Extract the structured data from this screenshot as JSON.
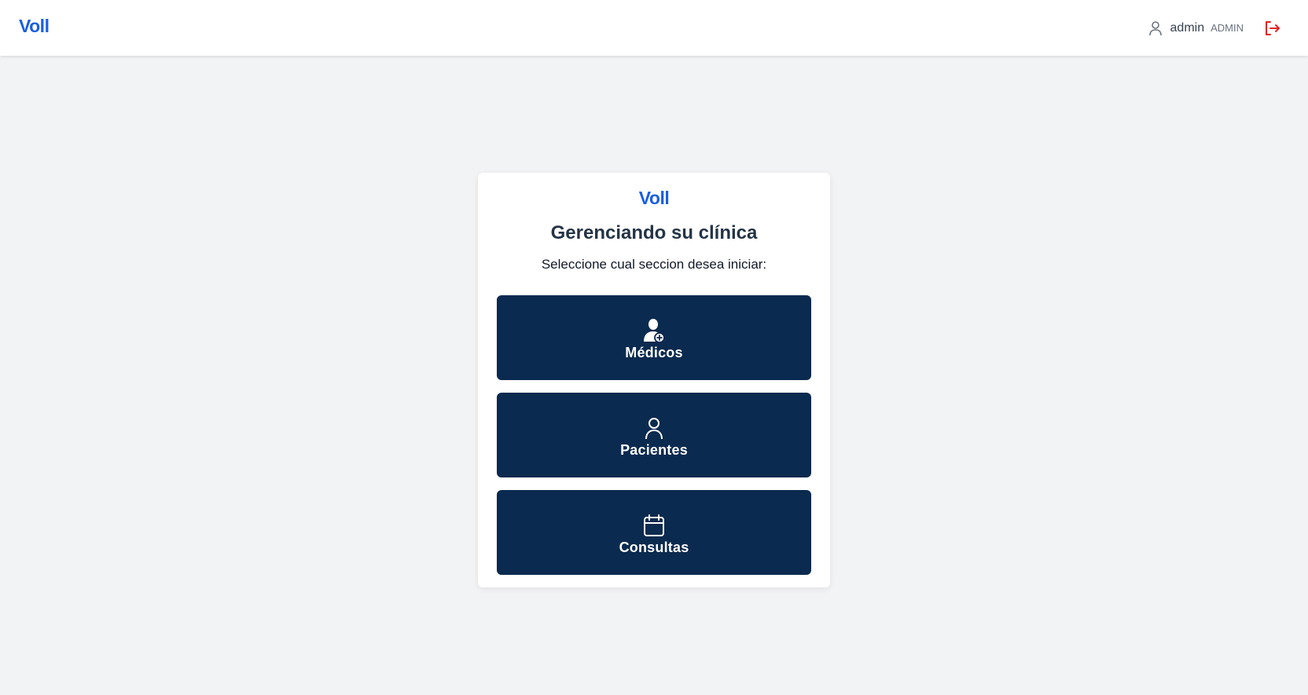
{
  "header": {
    "brand": "Voll",
    "user": {
      "icon": "user-icon",
      "name": "admin",
      "role": "ADMIN"
    },
    "logout_icon": "logout-icon"
  },
  "card": {
    "logo": "Voll",
    "title": "Gerenciando su clínica",
    "subtitle": "Seleccione cual seccion desea iniciar:",
    "sections": [
      {
        "icon": "doctor-icon",
        "label": "Médicos"
      },
      {
        "icon": "user-icon",
        "label": "Pacientes"
      },
      {
        "icon": "calendar-icon",
        "label": "Consultas"
      }
    ]
  },
  "colors": {
    "brand": "#1a5fe0",
    "button_bg": "#0b2a4f",
    "logout": "#e02424",
    "page_bg": "#f2f3f5"
  }
}
